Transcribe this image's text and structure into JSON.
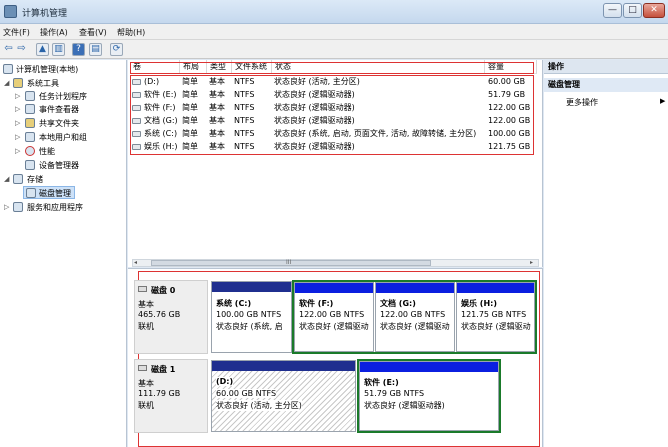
{
  "window": {
    "title": "计算机管理",
    "buttons": {
      "minimize": "—",
      "maximize": "□",
      "close": "✕"
    }
  },
  "menu": [
    "文件(F)",
    "操作(A)",
    "查看(V)",
    "帮助(H)"
  ],
  "tree": {
    "root": "计算机管理(本地)",
    "items": [
      {
        "label": "系统工具",
        "level": 1,
        "expander": "◢"
      },
      {
        "label": "任务计划程序",
        "level": 2,
        "expander": "▷"
      },
      {
        "label": "事件查看器",
        "level": 2,
        "expander": "▷"
      },
      {
        "label": "共享文件夹",
        "level": 2,
        "expander": "▷"
      },
      {
        "label": "本地用户和组",
        "level": 2,
        "expander": "▷"
      },
      {
        "label": "性能",
        "level": 2,
        "expander": "▷"
      },
      {
        "label": "设备管理器",
        "level": 2,
        "expander": ""
      },
      {
        "label": "存储",
        "level": 1,
        "expander": "◢"
      },
      {
        "label": "磁盘管理",
        "level": 2,
        "expander": "",
        "selected": true
      },
      {
        "label": "服务和应用程序",
        "level": 1,
        "expander": "▷"
      }
    ]
  },
  "volumes": {
    "headers": {
      "vol": "卷",
      "layout": "布局",
      "type": "类型",
      "fs": "文件系统",
      "status": "状态",
      "capacity": "容量"
    },
    "rows": [
      {
        "vol": "(D:)",
        "layout": "简单",
        "type": "基本",
        "fs": "NTFS",
        "status": "状态良好 (活动, 主分区)",
        "capacity": "60.00 GB"
      },
      {
        "vol": "软件 (E:)",
        "layout": "简单",
        "type": "基本",
        "fs": "NTFS",
        "status": "状态良好 (逻辑驱动器)",
        "capacity": "51.79 GB"
      },
      {
        "vol": "软件 (F:)",
        "layout": "简单",
        "type": "基本",
        "fs": "NTFS",
        "status": "状态良好 (逻辑驱动器)",
        "capacity": "122.00 GB"
      },
      {
        "vol": "文档 (G:)",
        "layout": "简单",
        "type": "基本",
        "fs": "NTFS",
        "status": "状态良好 (逻辑驱动器)",
        "capacity": "122.00 GB"
      },
      {
        "vol": "系统 (C:)",
        "layout": "简单",
        "type": "基本",
        "fs": "NTFS",
        "status": "状态良好 (系统, 启动, 页面文件, 活动, 故障转储, 主分区)",
        "capacity": "100.00 GB"
      },
      {
        "vol": "娱乐 (H:)",
        "layout": "简单",
        "type": "基本",
        "fs": "NTFS",
        "status": "状态良好 (逻辑驱动器)",
        "capacity": "121.75 GB"
      }
    ]
  },
  "scroll_glyph": "III",
  "disks": [
    {
      "name": "磁盘 0",
      "type": "基本",
      "size": "465.76 GB",
      "state": "联机",
      "partitions": [
        {
          "name": "系统 (C:)",
          "size": "100.00 GB NTFS",
          "status": "状态良好 (系统, 启"
        },
        {
          "name": "软件 (F:)",
          "size": "122.00 GB NTFS",
          "status": "状态良好 (逻辑驱动"
        },
        {
          "name": "文档 (G:)",
          "size": "122.00 GB NTFS",
          "status": "状态良好 (逻辑驱动"
        },
        {
          "name": "娱乐 (H:)",
          "size": "121.75 GB NTFS",
          "status": "状态良好 (逻辑驱动"
        }
      ]
    },
    {
      "name": "磁盘 1",
      "type": "基本",
      "size": "111.79 GB",
      "state": "联机",
      "partitions": [
        {
          "name": "(D:)",
          "size": "60.00 GB NTFS",
          "status": "状态良好 (活动, 主分区)"
        },
        {
          "name": "软件 (E:)",
          "size": "51.79 GB NTFS",
          "status": "状态良好 (逻辑驱动器)"
        }
      ]
    }
  ],
  "actions": {
    "header": "操作",
    "section": "磁盘管理",
    "more": "更多操作",
    "more_arrow": "▶"
  },
  "colors": {
    "primary_partition": "#1f2f8f",
    "logical_partition": "#0b1fe0",
    "selection_green": "#1a7a2a",
    "annotation_red": "#dd3333"
  }
}
